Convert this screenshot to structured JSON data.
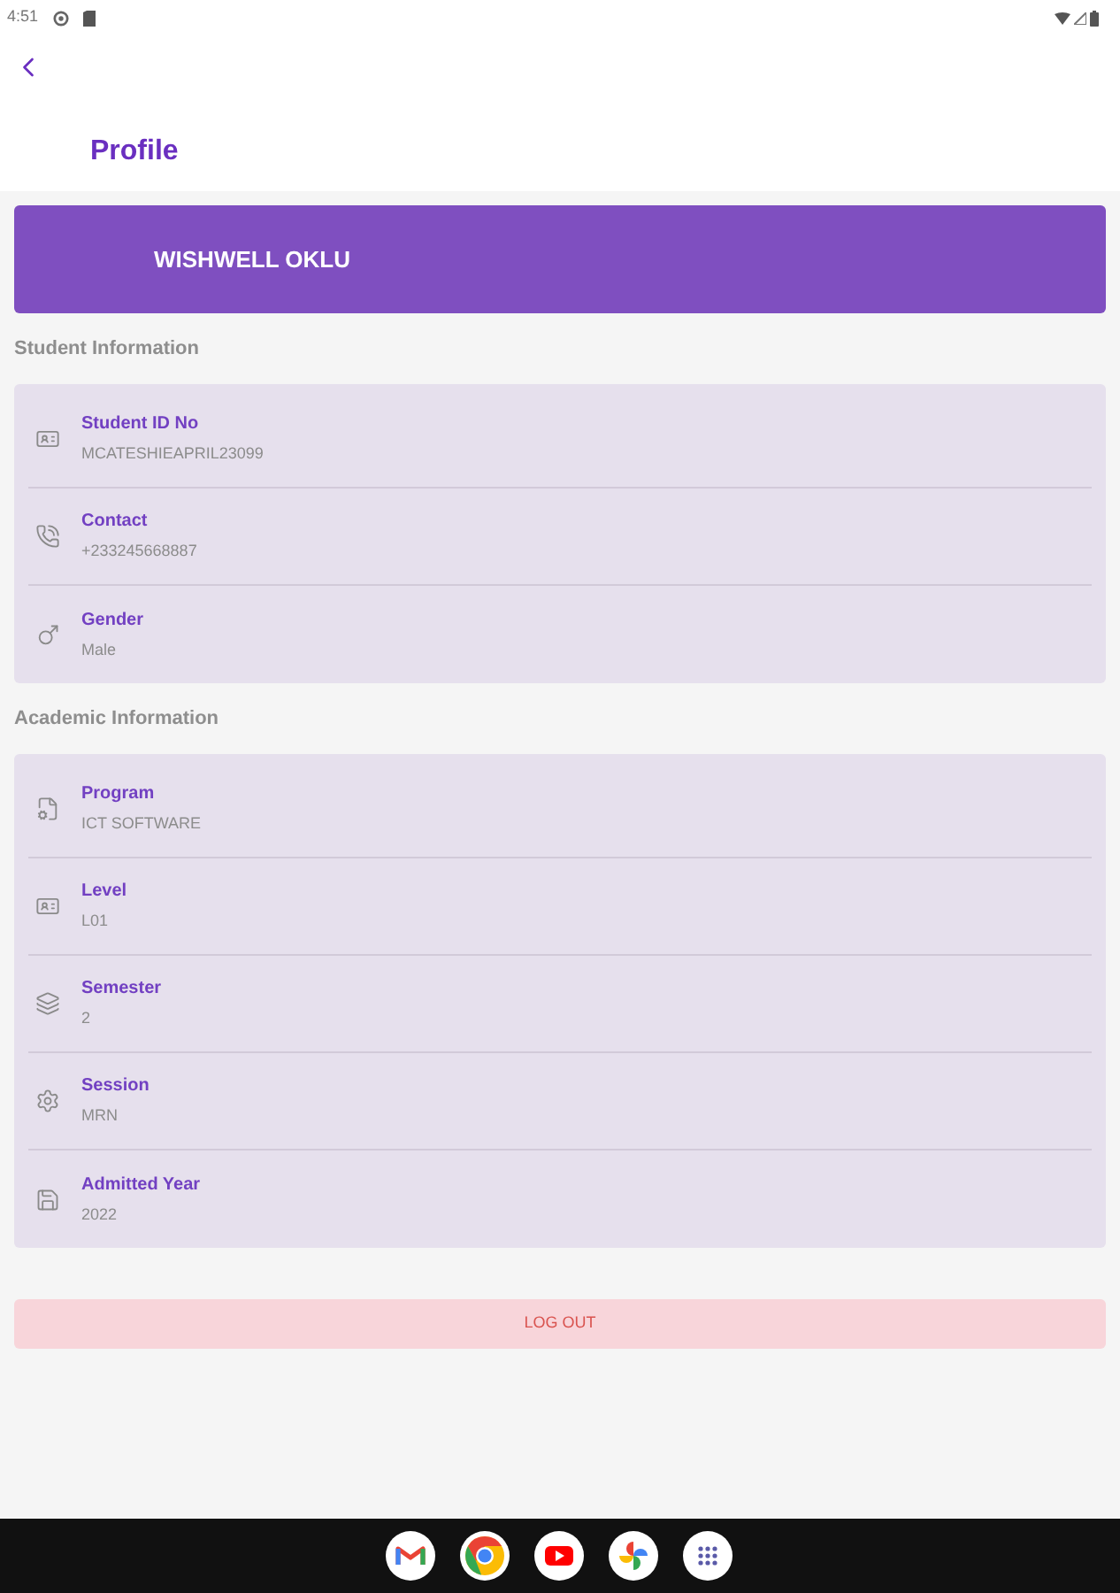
{
  "status_bar": {
    "time": "4:51"
  },
  "app_bar": {
    "title": "Profile"
  },
  "profile_card": {
    "name": "WISHWELL OKLU"
  },
  "sections": [
    {
      "heading": "Student Information",
      "rows": [
        {
          "kind": "id-card",
          "label": "Student ID No",
          "value": "MCATESHIEAPRIL23099"
        },
        {
          "kind": "phone",
          "label": "Contact",
          "value": "+233245668887"
        },
        {
          "kind": "gender",
          "label": "Gender",
          "value": "Male"
        }
      ]
    },
    {
      "heading": "Academic Information",
      "rows": [
        {
          "kind": "program",
          "label": "Program",
          "value": "ICT SOFTWARE"
        },
        {
          "kind": "id-card",
          "label": "Level",
          "value": "L01"
        },
        {
          "kind": "layers",
          "label": "Semester",
          "value": "2"
        },
        {
          "kind": "gear",
          "label": "Session",
          "value": "MRN"
        },
        {
          "kind": "save",
          "label": "Admitted Year",
          "value": "2022"
        }
      ]
    }
  ],
  "logout_button": {
    "label": "LOG OUT"
  },
  "dock": [
    {
      "kind": "mail"
    },
    {
      "kind": "browser"
    },
    {
      "kind": "video"
    },
    {
      "kind": "photos"
    },
    {
      "kind": "apps"
    }
  ]
}
